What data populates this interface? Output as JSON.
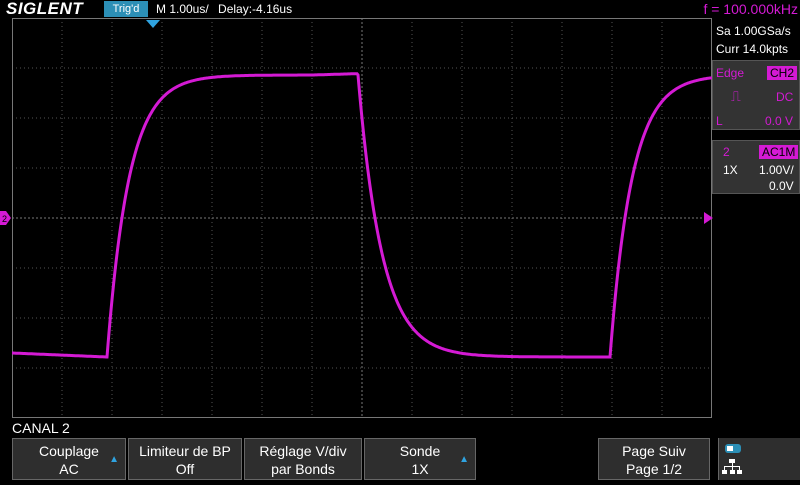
{
  "header": {
    "logo": "SIGLENT",
    "trig_status": "Trig'd",
    "timebase": "M 1.00us/",
    "delay": "Delay:-4.16us",
    "frequency": "f = 100.000kHz"
  },
  "acquisition": {
    "sample_rate": "Sa 1.00GSa/s",
    "memory": "Curr 14.0kpts"
  },
  "trigger": {
    "type": "Edge",
    "source": "CH2",
    "coupling": "DC",
    "mode": "L",
    "level": "0.0 V"
  },
  "channel": {
    "number": "2",
    "coupling_badge": "AC1M",
    "probe": "1X",
    "scale": "1.00V/",
    "offset": "0.0V"
  },
  "menu_title": "CANAL 2",
  "buttons": [
    {
      "line1": "Couplage",
      "line2": "AC"
    },
    {
      "line1": "Limiteur de BP",
      "line2": "Off"
    },
    {
      "line1": "Réglage V/div",
      "line2": "par Bonds"
    },
    {
      "line1": "Sonde",
      "line2": "1X"
    },
    {
      "line1": "Page Suiv",
      "line2": "Page 1/2"
    }
  ],
  "colors": {
    "channel2": "#d41ad4",
    "accent": "#2c8fb6",
    "grid": "#5a5a5a"
  },
  "waveform": {
    "channel": "CH2",
    "shape": "square-wave with exponential edges"
  }
}
